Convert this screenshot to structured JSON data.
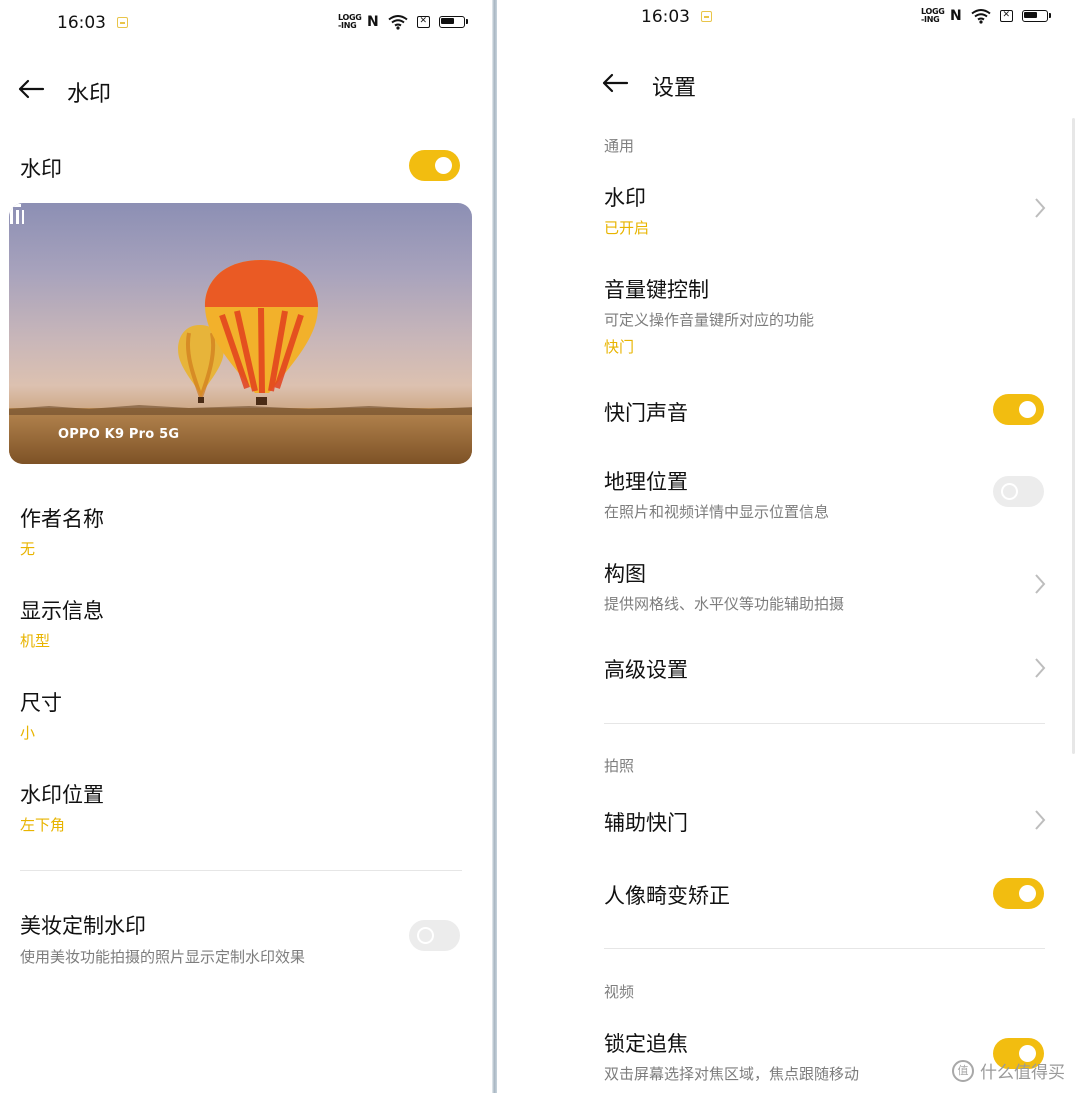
{
  "left": {
    "status": {
      "time": "16:03",
      "logging": "LOGG\n-ING",
      "nfc": "N",
      "box_glyph": "✕"
    },
    "header": {
      "title": "水印"
    },
    "watermark_toggle": {
      "label": "水印",
      "state": "on"
    },
    "preview": {
      "watermark_text": "OPPO K9 Pro 5G"
    },
    "items": [
      {
        "title": "作者名称",
        "value": "无"
      },
      {
        "title": "显示信息",
        "value": "机型"
      },
      {
        "title": "尺寸",
        "value": "小"
      },
      {
        "title": "水印位置",
        "value": "左下角"
      }
    ],
    "beauty": {
      "title": "美妆定制水印",
      "subtitle": "使用美妆功能拍摄的照片显示定制水印效果",
      "state": "off"
    }
  },
  "right": {
    "status": {
      "time": "16:03",
      "logging": "LOGG\n-ING",
      "nfc": "N",
      "box_glyph": "✕"
    },
    "header": {
      "title": "设置"
    },
    "sections": {
      "general": "通用",
      "photo": "拍照",
      "video": "视频"
    },
    "watermark": {
      "title": "水印",
      "value": "已开启"
    },
    "volume_key": {
      "title": "音量键控制",
      "subtitle": "可定义操作音量键所对应的功能",
      "value": "快门"
    },
    "shutter_sound": {
      "title": "快门声音",
      "state": "on"
    },
    "location": {
      "title": "地理位置",
      "subtitle": "在照片和视频详情中显示位置信息",
      "state": "off"
    },
    "composition": {
      "title": "构图",
      "subtitle": "提供网格线、水平仪等功能辅助拍摄"
    },
    "advanced": {
      "title": "高级设置"
    },
    "assist_shutter": {
      "title": "辅助快门"
    },
    "portrait_distortion": {
      "title": "人像畸变矫正",
      "state": "on"
    },
    "focus_lock": {
      "title": "锁定追焦",
      "subtitle": "双击屏幕选择对焦区域，焦点跟随移动",
      "state": "on"
    }
  },
  "site_watermark": {
    "icon": "值",
    "text": "什么值得买"
  },
  "colors": {
    "accent": "#f2bd10",
    "value_text": "#e8b400",
    "toggle_off": "#ececec"
  }
}
